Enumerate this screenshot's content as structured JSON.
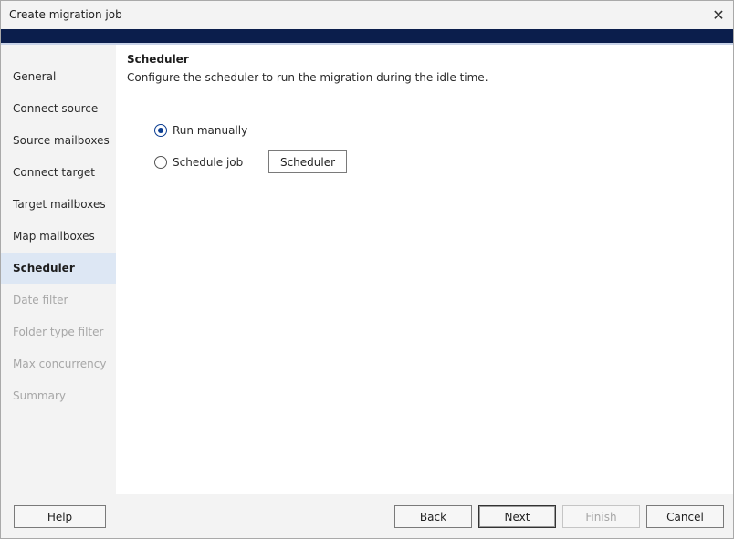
{
  "window": {
    "title": "Create migration job",
    "close_icon": "close-icon"
  },
  "colors": {
    "accent": "#0b1e4c",
    "active_item_bg": "#dde7f4",
    "radio_accent": "#0b3d91"
  },
  "sidebar": {
    "items": [
      {
        "label": "General",
        "state": "normal"
      },
      {
        "label": "Connect source",
        "state": "normal"
      },
      {
        "label": "Source mailboxes",
        "state": "normal"
      },
      {
        "label": "Connect target",
        "state": "normal"
      },
      {
        "label": "Target mailboxes",
        "state": "normal"
      },
      {
        "label": "Map mailboxes",
        "state": "normal"
      },
      {
        "label": "Scheduler",
        "state": "active"
      },
      {
        "label": "Date filter",
        "state": "disabled"
      },
      {
        "label": "Folder type filter",
        "state": "disabled"
      },
      {
        "label": "Max concurrency",
        "state": "disabled"
      },
      {
        "label": "Summary",
        "state": "disabled"
      }
    ]
  },
  "main": {
    "title": "Scheduler",
    "description": "Configure the scheduler to run the migration during the idle time.",
    "options": [
      {
        "label": "Run manually",
        "selected": true
      },
      {
        "label": "Schedule job",
        "selected": false
      }
    ],
    "scheduler_button": "Scheduler"
  },
  "footer": {
    "help": "Help",
    "back": "Back",
    "next": "Next",
    "finish": "Finish",
    "cancel": "Cancel"
  }
}
